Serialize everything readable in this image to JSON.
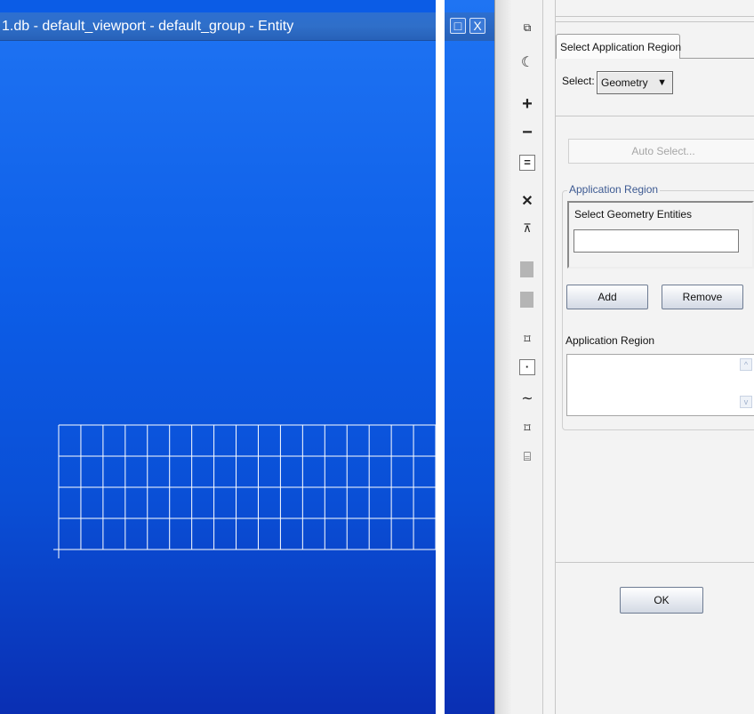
{
  "viewport": {
    "title": "1.db - default_viewport - default_group - Entity"
  },
  "window_controls": {
    "maximize_glyph": "□",
    "close_glyph": "X"
  },
  "toolbar": {
    "icons": [
      {
        "name": "copy-icon",
        "glyph": "⧉"
      },
      {
        "name": "curve-shape-icon",
        "glyph": "☾"
      },
      {
        "name": "plus-icon",
        "glyph": "+"
      },
      {
        "name": "minus-icon",
        "glyph": "−"
      },
      {
        "name": "equals-icon",
        "glyph": "="
      },
      {
        "name": "cross-tools-icon",
        "glyph": "✕"
      },
      {
        "name": "pick-filter-icon",
        "glyph": "⊼"
      },
      {
        "name": "solid-face-icon",
        "glyph": ""
      },
      {
        "name": "solid-face-2-icon",
        "glyph": ""
      },
      {
        "name": "surface-icon",
        "glyph": "⌑"
      },
      {
        "name": "point-icon",
        "glyph": "·"
      },
      {
        "name": "curve-icon",
        "glyph": "∼"
      },
      {
        "name": "surface-2-icon",
        "glyph": "⌑"
      },
      {
        "name": "solid-icon",
        "glyph": "⌸"
      }
    ]
  },
  "form": {
    "tab_label": "Select Application Region",
    "select_label": "Select:",
    "select_value": "Geometry",
    "select_arrow": "▼",
    "auto_select_label": "Auto Select...",
    "group_legend": "Application Region",
    "geometry_entities_label": "Select Geometry Entities",
    "geometry_entities_value": "",
    "add_label": "Add",
    "remove_label": "Remove",
    "list_label": "Application Region",
    "scroll_up": "^",
    "scroll_down": "v",
    "ok_label": "OK"
  },
  "colors": {
    "viewport_background": "#0d5ee8",
    "titlebar": "#2f6fc9",
    "mesh_lines": "#ffffff",
    "panel_background": "#f3f3f3",
    "legend_text": "#3d5a92"
  }
}
